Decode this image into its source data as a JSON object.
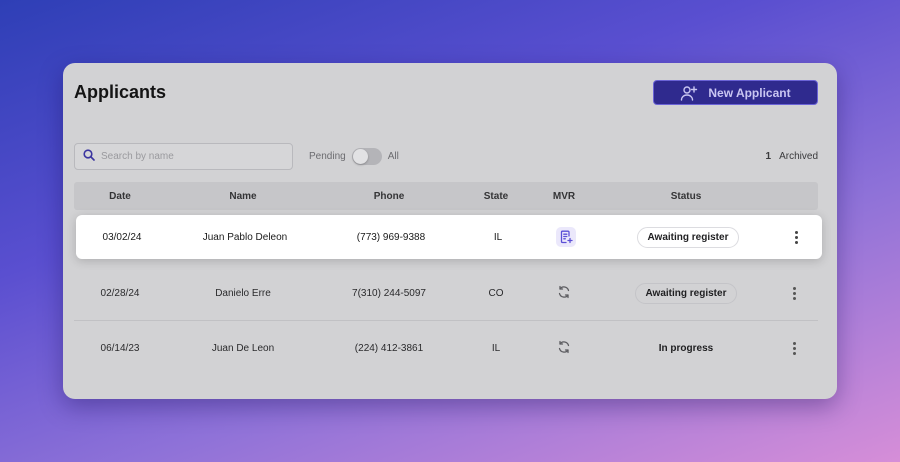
{
  "page": {
    "title": "Applicants",
    "new_button_label": "New Applicant",
    "colors": {
      "accent": "#2f2a8e",
      "mvr_icon": "#5b4fd6"
    }
  },
  "filters": {
    "search_placeholder": "Search by name",
    "toggle_left": "Pending",
    "toggle_right": "All",
    "toggle_value": "Pending",
    "archived_count": "1",
    "archived_label": "Archived"
  },
  "table": {
    "headers": {
      "date": "Date",
      "name": "Name",
      "phone": "Phone",
      "state": "State",
      "mvr": "MVR",
      "status": "Status"
    },
    "rows": [
      {
        "date": "03/02/24",
        "name": "Juan Pablo Deleon",
        "phone": "(773) 969-9388",
        "state": "IL",
        "mvr_icon": "document-check-icon",
        "status": "Awaiting register",
        "highlighted": true
      },
      {
        "date": "02/28/24",
        "name": "Danielo Erre",
        "phone": "7(310) 244-5097",
        "state": "CO",
        "mvr_icon": "refresh-icon",
        "status": "Awaiting register",
        "highlighted": false
      },
      {
        "date": "06/14/23",
        "name": "Juan De Leon",
        "phone": "(224) 412-3861",
        "state": "IL",
        "mvr_icon": "refresh-icon",
        "status": "In progress",
        "highlighted": false
      }
    ]
  }
}
